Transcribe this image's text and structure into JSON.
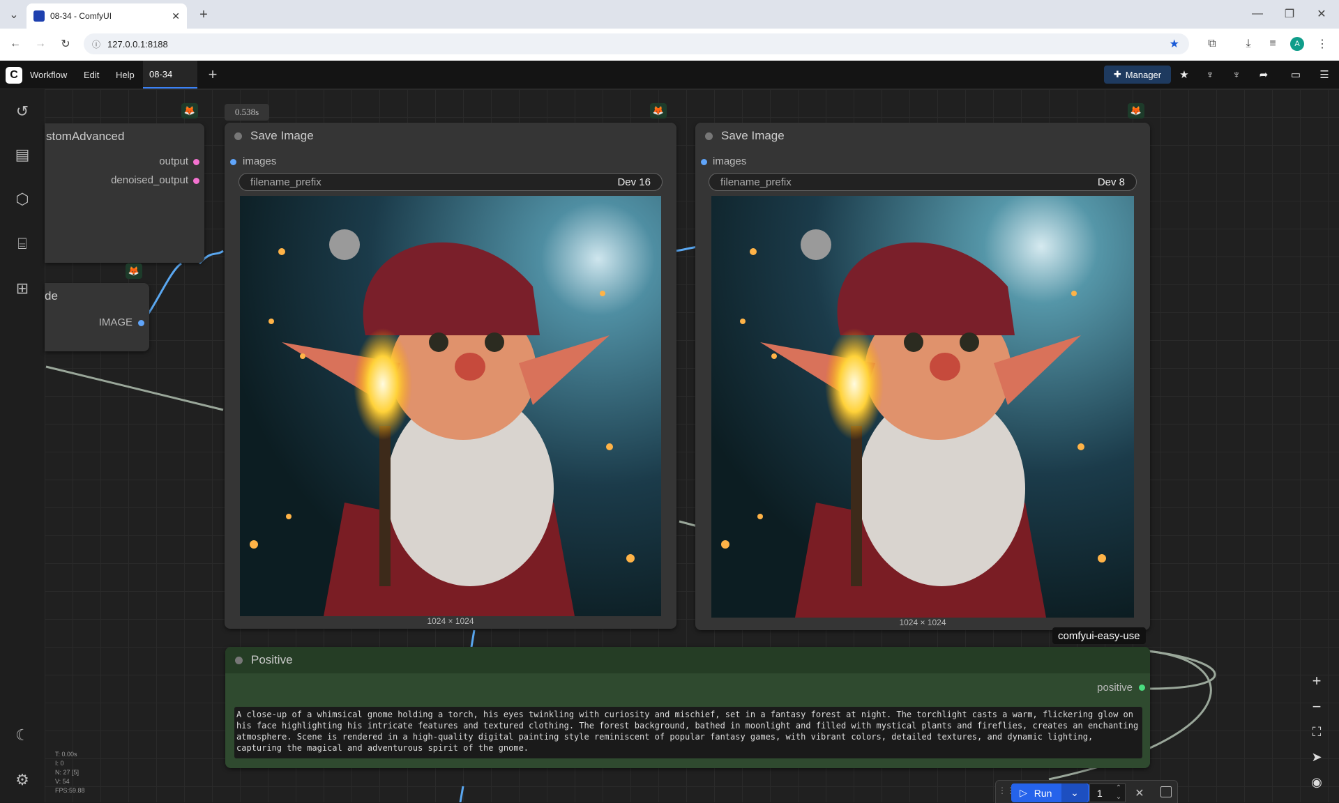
{
  "browser": {
    "tab_title": "08-34 - ComfyUI",
    "url": "127.0.0.1:8188"
  },
  "menubar": {
    "items": [
      "Workflow",
      "Edit",
      "Help"
    ],
    "workflow_tab": "08-34",
    "manager_label": "Manager"
  },
  "canvas": {
    "timing": "0.538s",
    "partial_node_top": {
      "title": "stomAdvanced",
      "outputs": [
        "output",
        "denoised_output"
      ]
    },
    "partial_node_bottom": {
      "title": "de",
      "output": "IMAGE"
    },
    "save_nodes": [
      {
        "title": "Save Image",
        "input": "images",
        "widget_label": "filename_prefix",
        "widget_value": "Dev 16",
        "size": "1024 × 1024"
      },
      {
        "title": "Save Image",
        "input": "images",
        "widget_label": "filename_prefix",
        "widget_value": "Dev 8",
        "size": "1024 × 1024"
      }
    ],
    "group_badge": "comfyui-easy-use",
    "positive_node": {
      "title": "Positive",
      "output": "positive",
      "text": "A close-up of a whimsical gnome holding a torch, his eyes twinkling with curiosity and mischief, set in a fantasy forest at night. The torchlight casts a warm, flickering glow on his face highlighting his intricate features and textured clothing. The forest background, bathed in moonlight and filled with mystical plants and fireflies, creates an enchanting atmosphere. Scene is rendered in a high-quality digital painting style reminiscent of popular fantasy games, with vibrant colors, detailed textures, and dynamic lighting, capturing the magical and adventurous spirit of the gnome."
    },
    "stats": [
      "T: 0.00s",
      "I: 0",
      "N: 27 [5]",
      "V: 54",
      "FPS:59.88"
    ]
  },
  "runbar": {
    "run_label": "Run",
    "batch_count": "1"
  },
  "colors": {
    "accent": "#3b82f6",
    "node_bg": "#353535",
    "positive_bg": "#2f4a2f",
    "pin_pink": "#f472d0",
    "pin_blue": "#60a5fa",
    "pin_green": "#4ade80"
  }
}
